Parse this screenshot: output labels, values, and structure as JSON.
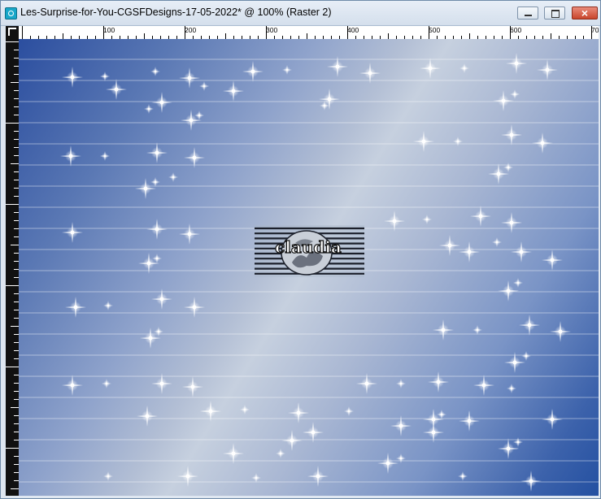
{
  "window": {
    "title": "Les-Surprise-for-You-CGSFDesigns-17-05-2022* @ 100% (Raster 2)",
    "buttons": {
      "minimize": "minimize-icon",
      "maximize": "maximize-icon",
      "close": "×"
    }
  },
  "ruler": {
    "ticks": [
      "100",
      "200",
      "300",
      "400",
      "500",
      "600",
      "70"
    ]
  },
  "canvas": {
    "layer": "Raster 2",
    "zoom": "100%",
    "watermark_text": "claudia"
  },
  "colors": {
    "gradient_dark": "#2450a1",
    "gradient_light": "#c6d0df",
    "close_button": "#c8462c"
  }
}
